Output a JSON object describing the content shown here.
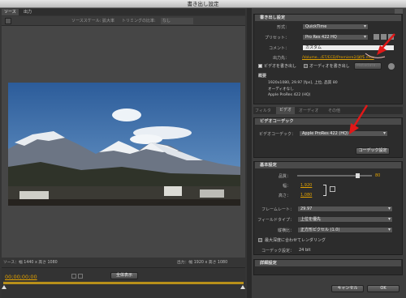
{
  "window": {
    "title": "書き出し設定"
  },
  "left": {
    "tabs": [
      "ソース",
      "出力"
    ],
    "toolbar": [
      "ソーススケール:",
      "拡大率",
      "トリミングの比率:",
      "なし"
    ],
    "status_source": "ソース：幅 1440 x 高さ 1080",
    "status_output": "出力：幅 1920 x 高さ 1080",
    "timecode": "00;00;00;00",
    "range_label": "全体表示",
    "colors": {
      "accent": "#e0a000"
    }
  },
  "export_settings": {
    "header": "書き出し設定",
    "format_label": "形式：",
    "format_value": "QuickTime",
    "preset_label": "プリセット：",
    "preset_value": "Pro Res 422 HQ",
    "comment_label": "コメント：",
    "comment_value": "カスタム",
    "output_label": "出力先：",
    "output_value": "/Volume.../ET/ECD/Premiere2/試作.mov",
    "export_video": "ビデオを書き出し",
    "export_audio": "オーディオを書き出し",
    "metadata_btn": "Metadata...",
    "summary_title": "概要",
    "summary_lines": [
      "1920x1080, 29.97 [fps], 上位, 品質 80",
      "オーディオなし",
      "Apple ProRes 422 (HQ)"
    ]
  },
  "right_tabs": [
    "フィルタ",
    "ビデオ",
    "オーディオ",
    "その他"
  ],
  "video_codec": {
    "header": "ビデオコーデック",
    "codec_label": "ビデオコーデック：",
    "codec_value": "Apple ProRes 422 (HQ)",
    "codec_settings_btn": "コーデック設定"
  },
  "basic": {
    "header": "基本設定",
    "quality_label": "品質：",
    "quality_value": "80",
    "quality_fraction": 0.8,
    "width_label": "幅：",
    "width_value": "1,920",
    "height_label": "高さ：",
    "height_value": "1,080",
    "framerate_label": "フレームレート：",
    "framerate_value": "29.97",
    "field_label": "フィールドタイプ：",
    "field_value": "上位を優先",
    "aspect_label": "縦横比：",
    "aspect_value": "正方形ピクセル (1.0)",
    "max_depth": "最大深度に合わせてレンダリング",
    "keyframe_label": "コーデック設定：",
    "keyframe_value": "24 bit"
  },
  "advanced": {
    "header": "詳細設定"
  },
  "footer": {
    "cancel": "キャンセル",
    "ok": "OK"
  }
}
